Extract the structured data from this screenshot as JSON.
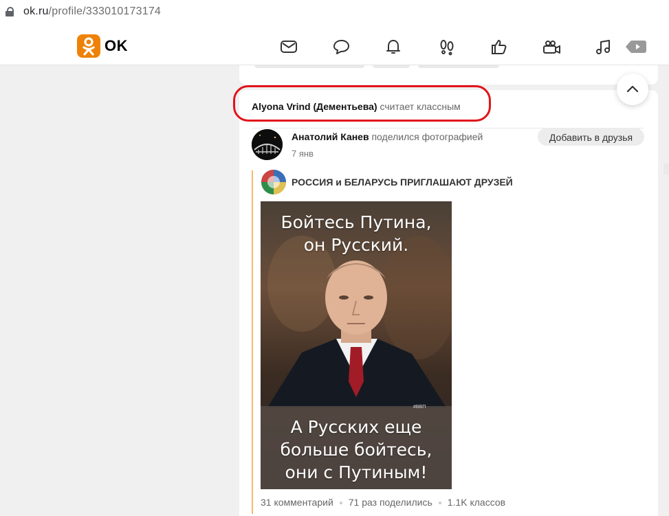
{
  "browser": {
    "url_host": "ok.ru",
    "url_path": "/profile/333010173174"
  },
  "header": {
    "logo_text": "OK",
    "brand_color": "#ee8208",
    "nav_icons": [
      "mail-icon",
      "chat-icon",
      "bell-icon",
      "footprints-icon",
      "like-icon",
      "video-camera-icon",
      "music-icon",
      "video-play-icon"
    ]
  },
  "feed": {
    "liked_by": {
      "name": "Alyona Vrind (Дементьева)",
      "action": "считает классным"
    },
    "post": {
      "author": "Анатолий Канев",
      "action": "поделился фотографией",
      "date": "7 янв",
      "add_friend_label": "Добавить в друзья",
      "group_name": "РОССИЯ и БЕЛАРУСЬ ПРИГЛАШАЮТ ДРУЗЕЙ",
      "photo": {
        "caption_top": [
          "Бойтесь Путина,",
          "он Русский."
        ],
        "caption_bottom": [
          "А Русских еще",
          "больше бойтесь,",
          "они с Путиным!"
        ],
        "watermark": "#ВВП"
      },
      "stats": {
        "comments": "31 комментарий",
        "shares": "71 раз поделились",
        "likes": "1.1K классов"
      }
    }
  },
  "highlight_color": "#e1131a"
}
